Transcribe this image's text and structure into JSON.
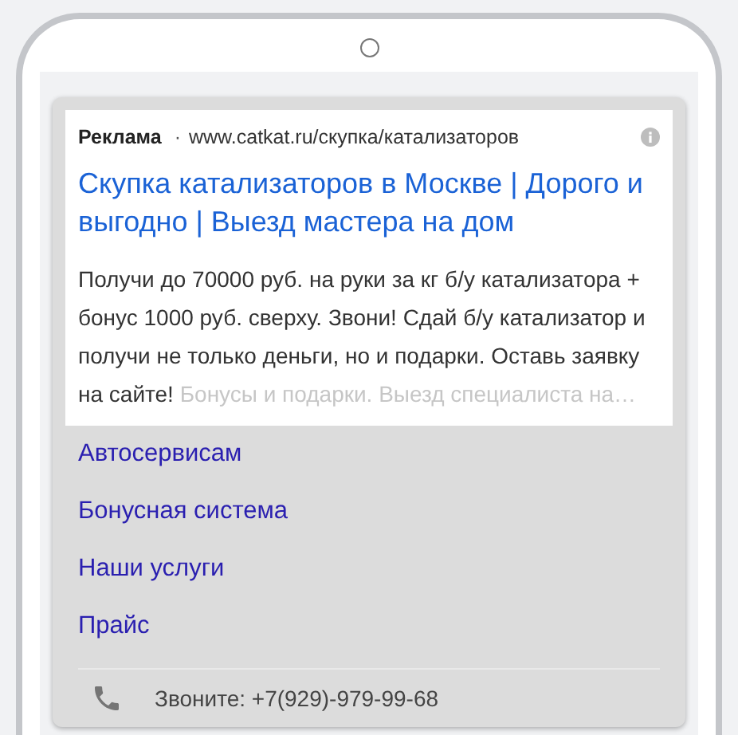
{
  "ad": {
    "label": "Реклама",
    "separator": "·",
    "url": "www.catkat.ru/скупка/катализаторов",
    "title": "Скупка катализаторов в Москве | Дорого и выгодно | Выезд мастера на дом",
    "description": {
      "text": "Получи до 70000 руб. на руки за кг б/у катализатора + бонус 1000 руб. сверху. Звони! Сдай б/у катализатор и получи не только деньги, но и подарки. Оставь заявку на сайте!",
      "faded": "Бонусы и подарки. Выезд специалиста на…"
    }
  },
  "sitelinks": [
    "Автосервисам",
    "Бонусная система",
    "Наши услуги",
    "Прайс"
  ],
  "call": {
    "text": "Звоните: +7(929)-979-99-68"
  }
}
